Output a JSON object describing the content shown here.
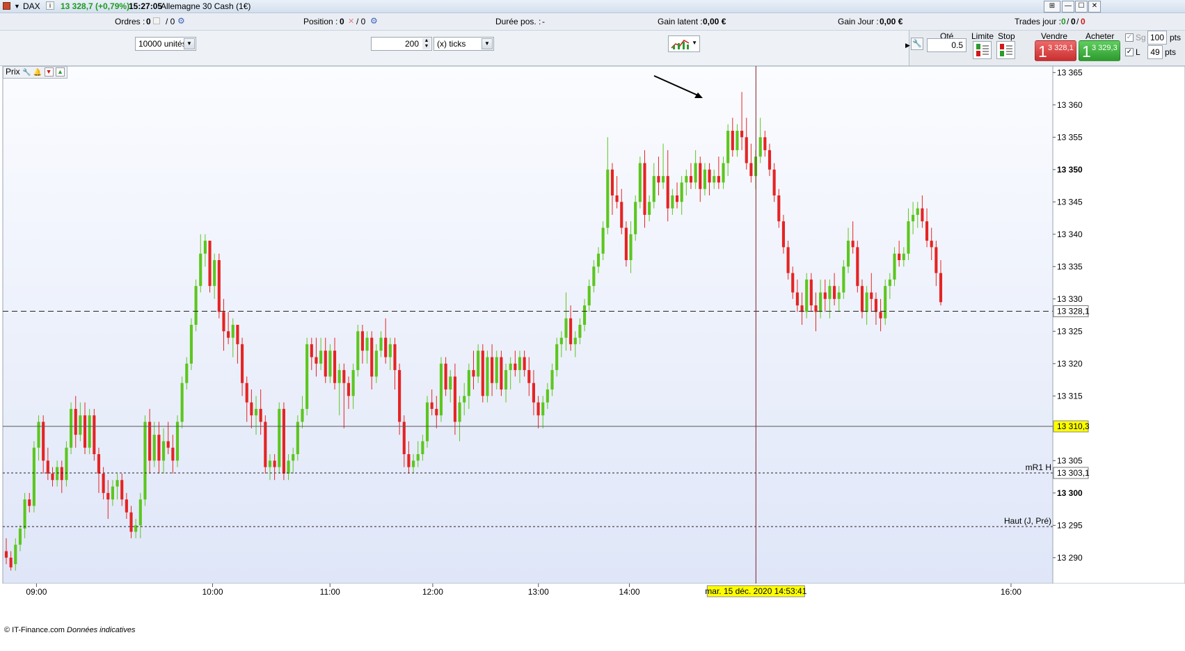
{
  "titlebar": {
    "symbol": "DAX",
    "price_change": "13 328,7 (+0,79%)",
    "time": "15:27:05",
    "instrument": "Allemagne 30 Cash (1€)",
    "window_buttons": [
      "⊞",
      "—",
      "☐",
      "✕"
    ]
  },
  "infobar": {
    "orders_label": "Ordres :",
    "orders_value": "0",
    "orders_sep": "/ 0",
    "position_label": "Position :",
    "position_value": "0",
    "duration_label": "Durée pos. :",
    "duration_value": "-",
    "gain_latent_label": "Gain latent :",
    "gain_latent_value": "0,00 €",
    "gain_jour_label": "Gain Jour :",
    "gain_jour_value": "0,00 €",
    "trades_label": "Trades jour :",
    "trades_values": [
      "0",
      "0",
      "0"
    ]
  },
  "toolbar": {
    "units_value": "10000 unités",
    "ticks_count": "200",
    "ticks_unit": "(x) ticks"
  },
  "order_panel": {
    "qty_label": "Qté",
    "qty_value": "0.5",
    "limit_label": "Limite",
    "stop_label": "Stop",
    "sell_label": "Vendre",
    "sell_big": "1",
    "sell_price": "3 328,1",
    "buy_label": "Acheter",
    "buy_big": "1",
    "buy_price": "3 329,3",
    "sg_label": "Sg",
    "sg_value": "100",
    "l_label": "L",
    "l_value": "49",
    "pts_label": "pts"
  },
  "chart_label": "Prix",
  "credit": "© IT-Finance.com",
  "credit_note": "Données indicatives",
  "colors": {
    "up": "#5cc61f",
    "down": "#e52323",
    "crosshair_label": "#ffff00"
  },
  "chart_data": {
    "type": "candlestick",
    "ylim": [
      13286,
      13366
    ],
    "y_ticks": [
      "13 365",
      "13 360",
      "13 355",
      "13 350",
      "13 345",
      "13 340",
      "13 335",
      "13 330",
      "13 325",
      "13 320",
      "13 315",
      "13 310",
      "13 305",
      "13 300",
      "13 295",
      "13 290"
    ],
    "y_tick_values": [
      13365,
      13360,
      13355,
      13350,
      13345,
      13340,
      13335,
      13330,
      13325,
      13320,
      13315,
      13310,
      13305,
      13300,
      13295,
      13290
    ],
    "bold_ticks": [
      "13 350",
      "13 300"
    ],
    "x_ticks": [
      "09:00",
      "10:00",
      "11:00",
      "12:00",
      "13:00",
      "14:00",
      "16:00"
    ],
    "x_tick_minutes": [
      540,
      600,
      640,
      675,
      711,
      742,
      872
    ],
    "x_range_minutes": [
      529,
      886
    ],
    "price_lines": [
      {
        "label": "13 328,1",
        "value": 13328.1,
        "style": "dashed"
      },
      {
        "label": "13 310,3",
        "value": 13310.3,
        "style": "crosshair"
      },
      {
        "label": "13 303,1",
        "value": 13303.1,
        "style": "dotted",
        "name": "mR1 H"
      },
      {
        "label": "",
        "value": 13294.8,
        "style": "dotted",
        "name": "Haut (J, Pré)"
      }
    ],
    "crosshair_time_label": "mar. 15 déc. 2020 14:53:41",
    "crosshair_minutes": 785.1,
    "candles_ohlc": [
      [
        13291,
        13293,
        13289,
        13290
      ],
      [
        13290,
        13291,
        13288,
        13288.5
      ],
      [
        13289,
        13293,
        13288,
        13292
      ],
      [
        13292,
        13295,
        13291,
        13294.5
      ],
      [
        13294.5,
        13300,
        13293,
        13299
      ],
      [
        13299,
        13300,
        13297,
        13298
      ],
      [
        13298,
        13308,
        13297,
        13307
      ],
      [
        13307,
        13312,
        13305,
        13311
      ],
      [
        13311,
        13312,
        13303,
        13305
      ],
      [
        13305,
        13307,
        13302,
        13303
      ],
      [
        13303,
        13304,
        13301,
        13302
      ],
      [
        13302,
        13305,
        13301,
        13304
      ],
      [
        13304,
        13305,
        13300,
        13302
      ],
      [
        13302,
        13308,
        13301,
        13307
      ],
      [
        13307,
        13314,
        13306,
        13313
      ],
      [
        13313,
        13315,
        13307,
        13309
      ],
      [
        13309,
        13314,
        13308,
        13312
      ],
      [
        13312,
        13314,
        13306,
        13307
      ],
      [
        13307,
        13313,
        13306,
        13312
      ],
      [
        13312,
        13313,
        13305,
        13306
      ],
      [
        13306,
        13307,
        13300,
        13303
      ],
      [
        13303,
        13304,
        13299,
        13300
      ],
      [
        13300,
        13302,
        13296,
        13299
      ],
      [
        13299,
        13302,
        13298,
        13301
      ],
      [
        13301,
        13303,
        13299,
        13302
      ],
      [
        13302,
        13303,
        13298,
        13299
      ],
      [
        13299,
        13300,
        13296,
        13297
      ],
      [
        13297,
        13298,
        13293,
        13294
      ],
      [
        13294,
        13296,
        13293,
        13295
      ],
      [
        13295,
        13300,
        13293,
        13299
      ],
      [
        13299,
        13312,
        13298,
        13311
      ],
      [
        13311,
        13313,
        13303,
        13305
      ],
      [
        13305,
        13311,
        13304,
        13309
      ],
      [
        13309,
        13311,
        13303,
        13305
      ],
      [
        13305,
        13310,
        13303,
        13308
      ],
      [
        13308,
        13311,
        13306,
        13307
      ],
      [
        13307,
        13309,
        13303,
        13305
      ],
      [
        13305,
        13312,
        13304,
        13311
      ],
      [
        13311,
        13318,
        13310,
        13317
      ],
      [
        13317,
        13321,
        13316,
        13320
      ],
      [
        13320,
        13327,
        13319,
        13326
      ],
      [
        13326,
        13333,
        13325,
        13332
      ],
      [
        13332,
        13340,
        13331,
        13337
      ],
      [
        13337,
        13340,
        13335,
        13339
      ],
      [
        13339,
        13339,
        13331,
        13332
      ],
      [
        13332,
        13337,
        13330,
        13336
      ],
      [
        13336,
        13337,
        13327,
        13328
      ],
      [
        13328,
        13330,
        13322,
        13325
      ],
      [
        13325,
        13328,
        13323,
        13324
      ],
      [
        13324,
        13327,
        13321,
        13326
      ],
      [
        13326,
        13326,
        13320,
        13323
      ],
      [
        13323,
        13324,
        13315,
        13317
      ],
      [
        13317,
        13318,
        13311,
        13314
      ],
      [
        13314,
        13316,
        13310,
        13312
      ],
      [
        13312,
        13315,
        13309,
        13313
      ],
      [
        13313,
        13316,
        13309,
        13311
      ],
      [
        13311,
        13312,
        13303,
        13304
      ],
      [
        13304,
        13306,
        13302,
        13305
      ],
      [
        13305,
        13306,
        13302,
        13304
      ],
      [
        13304,
        13314,
        13303,
        13313
      ],
      [
        13313,
        13314,
        13302,
        13303
      ],
      [
        13303,
        13306,
        13302,
        13305
      ],
      [
        13305,
        13307,
        13303,
        13306
      ],
      [
        13306,
        13312,
        13305,
        13311
      ],
      [
        13311,
        13315,
        13310,
        13313
      ],
      [
        13313,
        13324,
        13312,
        13323
      ],
      [
        13323,
        13324,
        13319,
        13321
      ],
      [
        13321,
        13324,
        13318,
        13320
      ],
      [
        13320,
        13324,
        13319,
        13322
      ],
      [
        13322,
        13324,
        13317,
        13318
      ],
      [
        13318,
        13323,
        13317,
        13322
      ],
      [
        13322,
        13324,
        13316,
        13317
      ],
      [
        13317,
        13320,
        13312,
        13319
      ],
      [
        13319,
        13320,
        13310,
        13317
      ],
      [
        13317,
        13318,
        13313,
        13315
      ],
      [
        13315,
        13320,
        13313,
        13319
      ],
      [
        13319,
        13326,
        13318,
        13325
      ],
      [
        13325,
        13326,
        13320,
        13322
      ],
      [
        13322,
        13325,
        13320,
        13324
      ],
      [
        13324,
        13325,
        13316,
        13318
      ],
      [
        13318,
        13323,
        13317,
        13322
      ],
      [
        13322,
        13325,
        13321,
        13324
      ],
      [
        13324,
        13327,
        13320,
        13321
      ],
      [
        13321,
        13324,
        13319,
        13323
      ],
      [
        13323,
        13324,
        13316,
        13319
      ],
      [
        13319,
        13320,
        13309,
        13311
      ],
      [
        13311,
        13312,
        13304,
        13306
      ],
      [
        13306,
        13308,
        13303,
        13304
      ],
      [
        13304,
        13306,
        13303,
        13305
      ],
      [
        13305,
        13308,
        13304,
        13306
      ],
      [
        13306,
        13309,
        13305,
        13308
      ],
      [
        13308,
        13315,
        13307,
        13314
      ],
      [
        13314,
        13316,
        13312,
        13313
      ],
      [
        13313,
        13315,
        13310,
        13312
      ],
      [
        13312,
        13321,
        13311,
        13320
      ],
      [
        13320,
        13321,
        13315,
        13316
      ],
      [
        13316,
        13319,
        13314,
        13318
      ],
      [
        13318,
        13320,
        13309,
        13311
      ],
      [
        13311,
        13315,
        13308,
        13314
      ],
      [
        13314,
        13317,
        13312,
        13315
      ],
      [
        13315,
        13320,
        13313,
        13319
      ],
      [
        13319,
        13322,
        13316,
        13318
      ],
      [
        13318,
        13323,
        13317,
        13322
      ],
      [
        13322,
        13323,
        13314,
        13315
      ],
      [
        13315,
        13322,
        13314,
        13321
      ],
      [
        13321,
        13323,
        13315,
        13317
      ],
      [
        13317,
        13322,
        13316,
        13321
      ],
      [
        13321,
        13322,
        13315,
        13316
      ],
      [
        13316,
        13320,
        13314,
        13319
      ],
      [
        13319,
        13321,
        13316,
        13320
      ],
      [
        13320,
        13322,
        13318,
        13319
      ],
      [
        13319,
        13322,
        13317,
        13321
      ],
      [
        13321,
        13322,
        13318,
        13319
      ],
      [
        13319,
        13321,
        13315,
        13317
      ],
      [
        13317,
        13319,
        13312,
        13314
      ],
      [
        13314,
        13315,
        13310,
        13312
      ],
      [
        13312,
        13315,
        13310,
        13314
      ],
      [
        13314,
        13317,
        13313,
        13316
      ],
      [
        13316,
        13320,
        13315,
        13319
      ],
      [
        13319,
        13324,
        13318,
        13323
      ],
      [
        13323,
        13325,
        13321,
        13324
      ],
      [
        13324,
        13331,
        13322,
        13327
      ],
      [
        13327,
        13329,
        13322,
        13323
      ],
      [
        13323,
        13325,
        13321,
        13324
      ],
      [
        13324,
        13327,
        13323,
        13326
      ],
      [
        13326,
        13330,
        13325,
        13329
      ],
      [
        13329,
        13333,
        13328,
        13332
      ],
      [
        13332,
        13336,
        13331,
        13335
      ],
      [
        13335,
        13338,
        13334,
        13337
      ],
      [
        13337,
        13342,
        13336,
        13341
      ],
      [
        13341,
        13355,
        13340,
        13350
      ],
      [
        13350,
        13351,
        13343,
        13346
      ],
      [
        13346,
        13349,
        13344,
        13345
      ],
      [
        13345,
        13347,
        13340,
        13341
      ],
      [
        13341,
        13342,
        13335,
        13336
      ],
      [
        13336,
        13342,
        13334,
        13340
      ],
      [
        13340,
        13346,
        13339,
        13345
      ],
      [
        13345,
        13352,
        13344,
        13351
      ],
      [
        13351,
        13353,
        13341,
        13343
      ],
      [
        13343,
        13346,
        13342,
        13345
      ],
      [
        13345,
        13351,
        13344,
        13349
      ],
      [
        13349,
        13352,
        13346,
        13348
      ],
      [
        13348,
        13354,
        13347,
        13349
      ],
      [
        13349,
        13353,
        13342,
        13344
      ],
      [
        13344,
        13347,
        13343,
        13346
      ],
      [
        13346,
        13348,
        13344,
        13345
      ],
      [
        13345,
        13349,
        13343,
        13348
      ],
      [
        13348,
        13350,
        13346,
        13349
      ],
      [
        13349,
        13351,
        13347,
        13348
      ],
      [
        13348,
        13353,
        13347,
        13351
      ],
      [
        13351,
        13352,
        13345,
        13347
      ],
      [
        13347,
        13351,
        13346,
        13350
      ],
      [
        13350,
        13351,
        13346,
        13348
      ],
      [
        13348,
        13350,
        13347,
        13349
      ],
      [
        13349,
        13352,
        13347,
        13348
      ],
      [
        13348,
        13352,
        13347,
        13351
      ],
      [
        13351,
        13357,
        13349,
        13356
      ],
      [
        13356,
        13358,
        13352,
        13353
      ],
      [
        13353,
        13357,
        13352,
        13356
      ],
      [
        13356,
        13362,
        13353,
        13355
      ],
      [
        13355,
        13358,
        13350,
        13351
      ],
      [
        13351,
        13354,
        13348,
        13349
      ],
      [
        13349,
        13353,
        13347,
        13352
      ],
      [
        13352,
        13358,
        13351,
        13355
      ],
      [
        13355,
        13356,
        13352,
        13353
      ],
      [
        13353,
        13354,
        13349,
        13350
      ],
      [
        13350,
        13351,
        13345,
        13346
      ],
      [
        13346,
        13347,
        13341,
        13342
      ],
      [
        13342,
        13343,
        13337,
        13338
      ],
      [
        13338,
        13339,
        13333,
        13334
      ],
      [
        13334,
        13335,
        13330,
        13331
      ],
      [
        13331,
        13333,
        13328,
        13329
      ],
      [
        13329,
        13331,
        13326,
        13328
      ],
      [
        13328,
        13334,
        13327,
        13333
      ],
      [
        13333,
        13334,
        13328,
        13329
      ],
      [
        13329,
        13331,
        13325,
        13328
      ],
      [
        13328,
        13333,
        13327,
        13331
      ],
      [
        13331,
        13333,
        13328,
        13330
      ],
      [
        13330,
        13333,
        13327,
        13332
      ],
      [
        13332,
        13334,
        13329,
        13330
      ],
      [
        13330,
        13332,
        13328,
        13331
      ],
      [
        13331,
        13336,
        13330,
        13335
      ],
      [
        13335,
        13341,
        13334,
        13339
      ],
      [
        13339,
        13342,
        13337,
        13338
      ],
      [
        13338,
        13339,
        13331,
        13332
      ],
      [
        13332,
        13333,
        13327,
        13328
      ],
      [
        13328,
        13332,
        13326,
        13331
      ],
      [
        13331,
        13334,
        13328,
        13330
      ],
      [
        13330,
        13331,
        13326,
        13328
      ],
      [
        13328,
        13330,
        13325,
        13327
      ],
      [
        13327,
        13333,
        13326,
        13332
      ],
      [
        13332,
        13334,
        13330,
        13333
      ],
      [
        13333,
        13338,
        13332,
        13337
      ],
      [
        13337,
        13339,
        13335,
        13336
      ],
      [
        13336,
        13338,
        13335,
        13337
      ],
      [
        13337,
        13344,
        13336,
        13342
      ],
      [
        13342,
        13345,
        13340,
        13343
      ],
      [
        13343,
        13345,
        13341,
        13344
      ],
      [
        13344,
        13346,
        13341,
        13342
      ],
      [
        13342,
        13344,
        13338,
        13339
      ],
      [
        13339,
        13341,
        13336,
        13338
      ],
      [
        13338,
        13339,
        13332,
        13334
      ],
      [
        13334,
        13336,
        13329,
        13329.5
      ]
    ]
  }
}
